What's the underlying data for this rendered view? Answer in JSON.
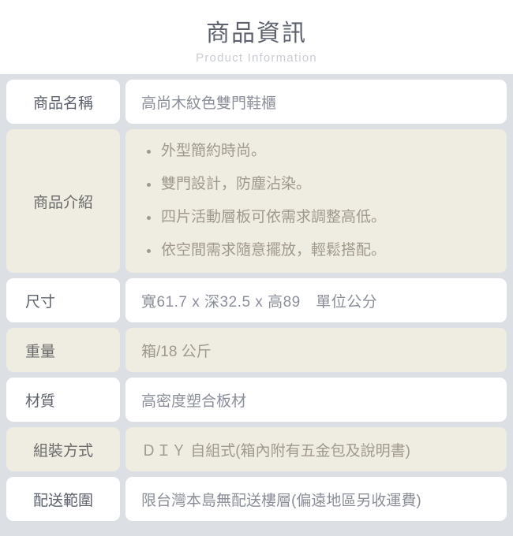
{
  "header": {
    "title": "商品資訊",
    "subtitle": "Product Information"
  },
  "table": {
    "rows": [
      {
        "label": "商品名稱",
        "value": "高尚木紋色雙門鞋櫃"
      },
      {
        "label": "商品介紹",
        "bullets": [
          "外型簡約時尚。",
          "雙門設計，防塵沾染。",
          "四片活動層板可依需求調整高低。",
          "依空間需求隨意擺放，輕鬆搭配。"
        ]
      },
      {
        "label": "尺寸",
        "value": "寬61.7 x 深32.5 x 高89　單位公分"
      },
      {
        "label": "重量",
        "value": "箱/18 公斤"
      },
      {
        "label": "材質",
        "value": "高密度塑合板材"
      },
      {
        "label": "組裝方式",
        "value": "ＤＩＹ 自組式(箱內附有五金包及說明書)"
      },
      {
        "label": "配送範圍",
        "value": "限台灣本島無配送樓層(偏遠地區另收運費)"
      }
    ]
  },
  "colors": {
    "page_background": "#ffffff",
    "table_background": "#dcdfe4",
    "row_white": "#ffffff",
    "row_beige": "#efece1",
    "title_text": "#5d626e",
    "subtitle_text": "#c9ccd2",
    "label_text": "#5d626e",
    "value_text": "#8b8f99",
    "value_text_beige": "#a09a8c"
  }
}
